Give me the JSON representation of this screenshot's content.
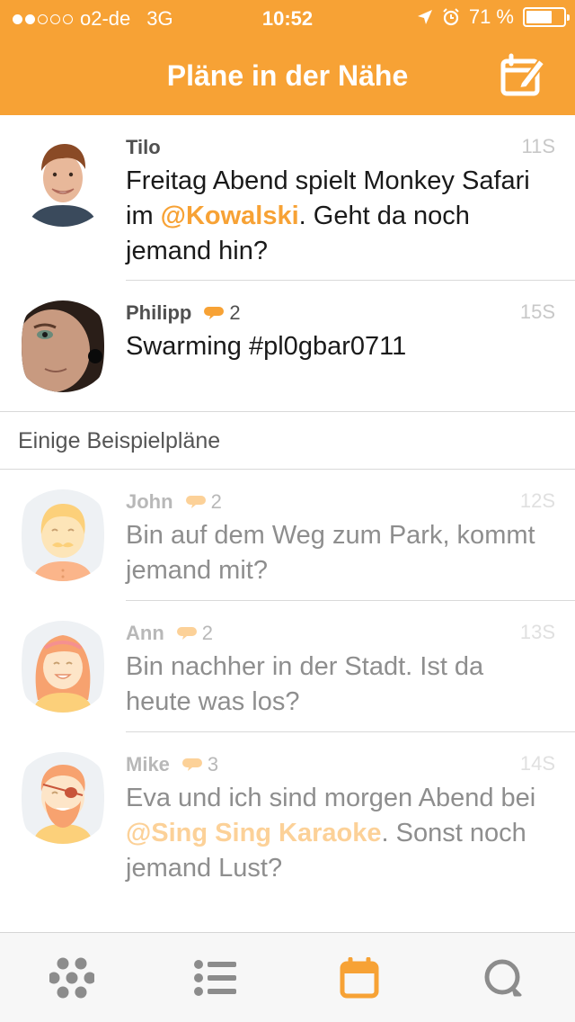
{
  "status_bar": {
    "carrier": "o2-de",
    "network": "3G",
    "time": "10:52",
    "battery": "71 %",
    "battery_level": 0.71,
    "signal_bars_filled": 2,
    "signal_bars_total": 5
  },
  "header": {
    "title": "Pläne in der Nähe",
    "compose_icon": "compose-calendar-icon",
    "background": "#f7a235"
  },
  "posts": [
    {
      "name": "Tilo",
      "time": "11S",
      "text_before": "Freitag Abend spielt Monkey Safari im ",
      "mention": "@Kowalski",
      "text_after": ". Geht da noch jemand hin?"
    },
    {
      "name": "Philipp",
      "comments": "2",
      "time": "15S",
      "text": "Swarming #pl0gbar0711"
    }
  ],
  "section": {
    "title": "Einige Beispielpläne"
  },
  "examples": [
    {
      "name": "John",
      "comments": "2",
      "time": "12S",
      "text": "Bin auf dem Weg zum Park, kommt jemand mit?"
    },
    {
      "name": "Ann",
      "comments": "2",
      "time": "13S",
      "text": "Bin nachher in der Stadt. Ist da heute was los?"
    },
    {
      "name": "Mike",
      "comments": "3",
      "time": "14S",
      "text_before": "Eva und ich sind morgen Abend bei ",
      "mention": "@Sing Sing Karaoke",
      "text_after": ". Sonst noch jemand Lust?"
    }
  ],
  "tabbar": {
    "tabs": [
      {
        "icon": "hive-icon",
        "active": false
      },
      {
        "icon": "list-icon",
        "active": false
      },
      {
        "icon": "calendar-icon",
        "active": true
      },
      {
        "icon": "chat-search-icon",
        "active": false
      }
    ],
    "active_color": "#f7a235",
    "inactive_color": "#8c8c8c"
  }
}
